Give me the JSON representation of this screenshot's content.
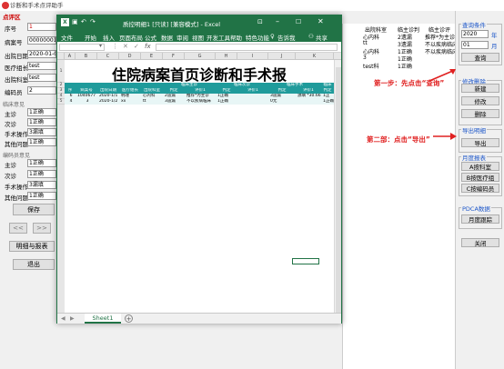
{
  "app": {
    "title": "诊断和手术点评助手"
  },
  "form": {
    "section_title": "点评区",
    "fields": [
      {
        "label": "序号",
        "value": "1"
      },
      {
        "label": "病案号",
        "value": "00000001"
      },
      {
        "label": "出院日期",
        "value": "2020-01-01"
      },
      {
        "label": "医疗组长",
        "value": "test"
      },
      {
        "label": "出院科室",
        "value": "test"
      },
      {
        "label": "编码员",
        "value": "2"
      }
    ],
    "group1_title": "临床意见",
    "group1": [
      {
        "label": "主诊",
        "value": "1正确"
      },
      {
        "label": "次诊",
        "value": "1正确"
      },
      {
        "label": "手术操作",
        "value": "3漏填"
      },
      {
        "label": "其他问题",
        "value": "1正确"
      }
    ],
    "group2_title": "编码员意见",
    "group2": [
      {
        "label": "主诊",
        "value": "1正确"
      },
      {
        "label": "次诊",
        "value": "1正确"
      },
      {
        "label": "手术操作",
        "value": "3漏填"
      },
      {
        "label": "其他问题",
        "value": "1正确"
      }
    ],
    "save_label": "保存",
    "prev_label": "<<",
    "next_label": ">>",
    "detail_label": "明细与报表",
    "exit_label": "退出"
  },
  "grid": {
    "headers": [
      "出院科室",
      "临主诊判"
    ],
    "rows": [
      [
        "心内科",
        "2遗漏"
      ],
      [
        "tt",
        "3遗漏"
      ],
      [
        "心内科",
        "1正确"
      ],
      [
        "3",
        "1正确"
      ],
      [
        "test科",
        "1正确"
      ]
    ],
    "col3_header": "临主诊评",
    "col3": [
      "推荐*为主诊",
      "不以疾病临床",
      "不以疾病临床",
      "",
      ""
    ]
  },
  "right": {
    "query_title": "查询条件",
    "year": "2020",
    "year_unit": "年",
    "month": "01",
    "month_unit": "月",
    "query_label": "查询",
    "modify_title": "修改删除",
    "add_label": "新建",
    "modify_label": "修改",
    "delete_label": "删除",
    "export_title": "导出明细",
    "export_label": "导出",
    "monthly_title": "月度报表",
    "rpt_a": "A按科室",
    "rpt_b": "B按医疗组",
    "rpt_c": "C按编码员",
    "pdca_title": "PDCA数据",
    "pdca_label": "月度跟踪",
    "close_label": "关闭"
  },
  "annotations": {
    "step1": "第一步：先点击“查询”",
    "step2": "第二部：点击“导出”"
  },
  "excel": {
    "title": "质控明细1 [只读] [兼容模式] - Excel",
    "share": "共享",
    "tabs": [
      "文件",
      "开始",
      "插入",
      "页面布局",
      "公式",
      "数据",
      "审阅",
      "视图",
      "开发工具",
      "帮助",
      "特色功能",
      "告诉我"
    ],
    "cols": [
      "A",
      "B",
      "C",
      "D",
      "E",
      "F",
      "G",
      "H",
      "I",
      "J",
      "K"
    ],
    "sheet_title": "住院病案首页诊断和手术报",
    "group_headers": [
      "临床主诊",
      "临床次诊",
      "临床手术",
      "临床"
    ],
    "headers": [
      "序",
      "病案号",
      "出院日期",
      "医疗组长",
      "出院科室",
      "判定",
      "评价1",
      "判定",
      "评价1",
      "判定",
      "评价1",
      "判定"
    ],
    "rows": [
      [
        "6",
        "1040677",
        "2020-1/1",
        "韩瑾",
        "心内科",
        "2遗漏",
        "推荐*为主诊",
        "1正确",
        "",
        "3遗漏",
        "源填 *30.66",
        "1正"
      ],
      [
        "4",
        "3",
        "2020-1/2",
        "xx",
        "tt",
        "3遗漏",
        "不以疾病临床",
        "1正确",
        "",
        "0无",
        "",
        "1正确"
      ]
    ],
    "sheet_tab": "Sheet1",
    "add_sheet": "+"
  }
}
